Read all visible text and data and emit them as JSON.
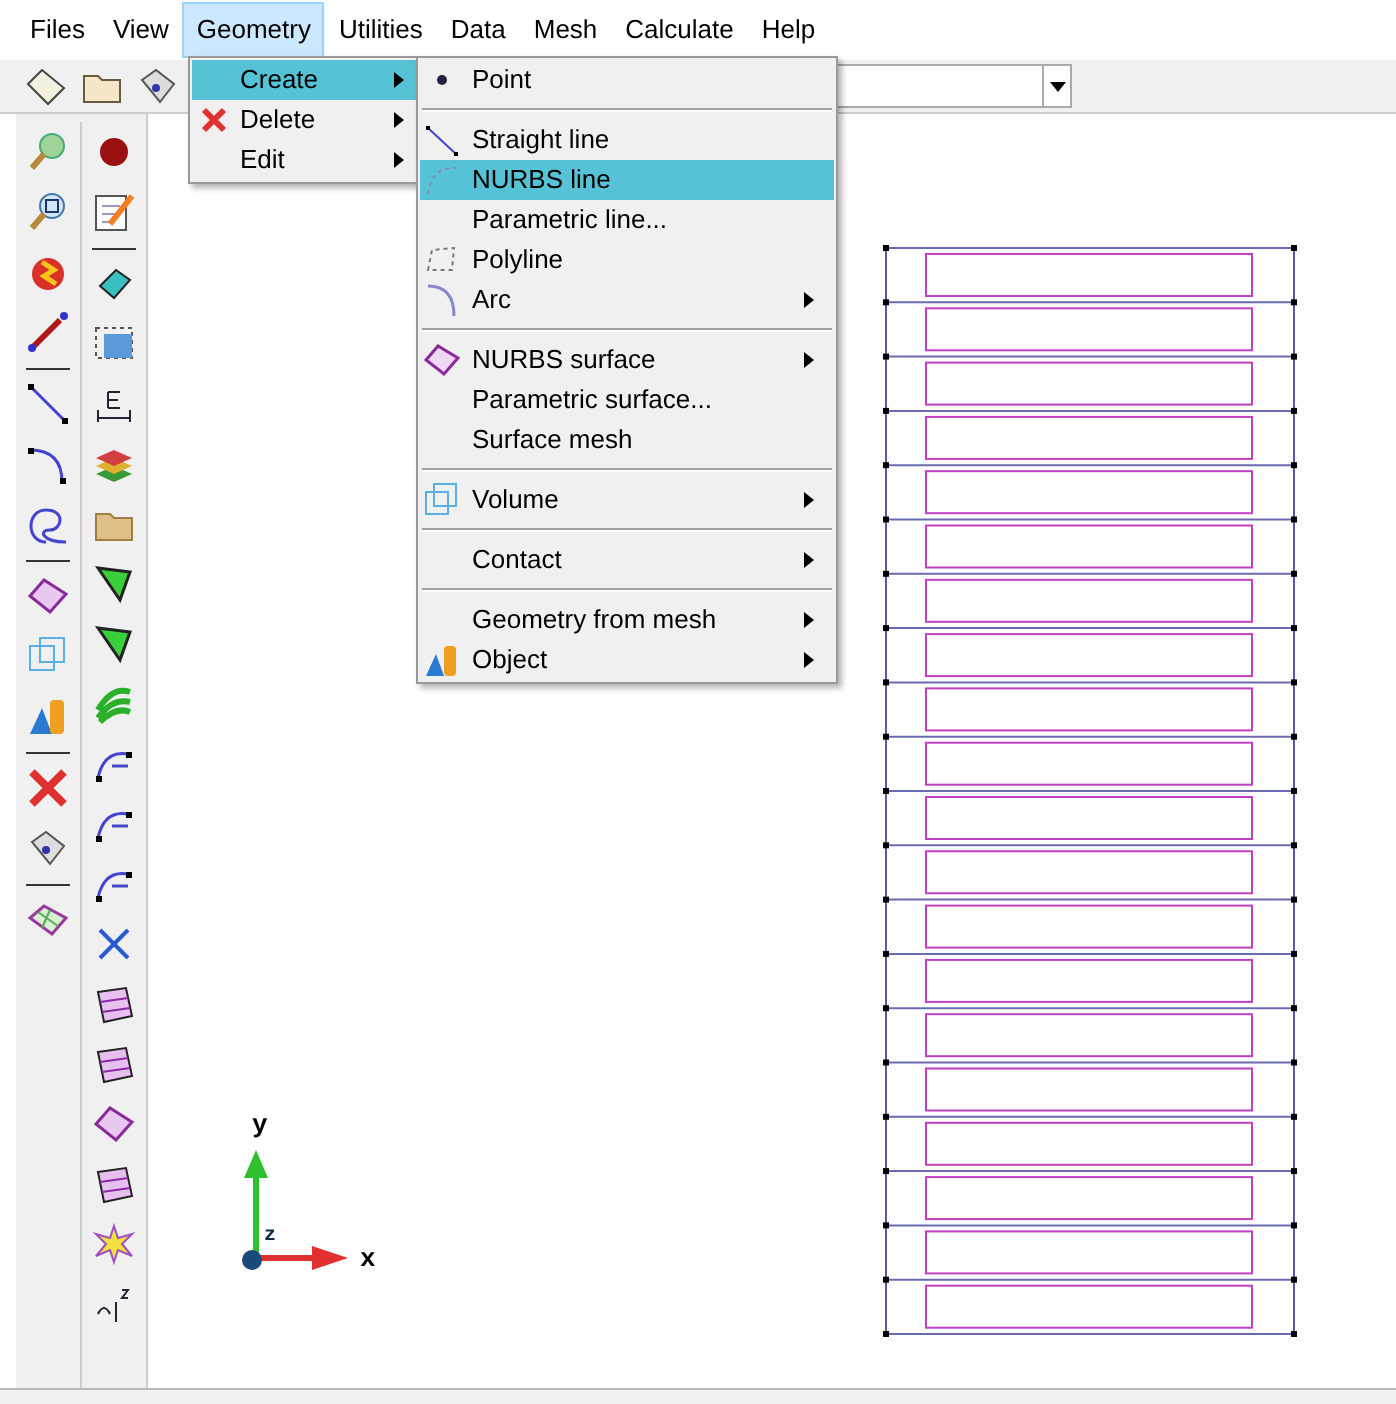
{
  "menu_bar": [
    {
      "label": "Files",
      "selected": false
    },
    {
      "label": "View",
      "selected": false
    },
    {
      "label": "Geometry",
      "selected": true
    },
    {
      "label": "Utilities",
      "selected": false
    },
    {
      "label": "Data",
      "selected": false
    },
    {
      "label": "Mesh",
      "selected": false
    },
    {
      "label": "Calculate",
      "selected": false
    },
    {
      "label": "Help",
      "selected": false
    }
  ],
  "geometry_menu": [
    {
      "label": "Create",
      "selected": true,
      "submenu": true
    },
    {
      "label": "Delete",
      "selected": false,
      "submenu": true
    },
    {
      "label": "Edit",
      "selected": false,
      "submenu": true
    }
  ],
  "create_submenu": [
    {
      "label": "Point",
      "selected": false,
      "submenu": false,
      "separator_before": false
    },
    {
      "label": "Straight line",
      "selected": false,
      "submenu": false,
      "separator_before": true
    },
    {
      "label": "NURBS line",
      "selected": true,
      "submenu": false,
      "separator_before": false
    },
    {
      "label": "Parametric line...",
      "selected": false,
      "submenu": false,
      "separator_before": false
    },
    {
      "label": "Polyline",
      "selected": false,
      "submenu": false,
      "separator_before": false
    },
    {
      "label": "Arc",
      "selected": false,
      "submenu": true,
      "separator_before": false
    },
    {
      "label": "NURBS surface",
      "selected": false,
      "submenu": true,
      "separator_before": true
    },
    {
      "label": "Parametric surface...",
      "selected": false,
      "submenu": false,
      "separator_before": false
    },
    {
      "label": "Surface mesh",
      "selected": false,
      "submenu": false,
      "separator_before": false
    },
    {
      "label": "Volume",
      "selected": false,
      "submenu": true,
      "separator_before": true
    },
    {
      "label": "Contact",
      "selected": false,
      "submenu": true,
      "separator_before": true
    },
    {
      "label": "Geometry from mesh",
      "selected": false,
      "submenu": true,
      "separator_before": true
    },
    {
      "label": "Object",
      "selected": false,
      "submenu": true,
      "separator_before": false
    }
  ],
  "axes": {
    "x_label": "x",
    "y_label": "y",
    "z_label": "z"
  }
}
